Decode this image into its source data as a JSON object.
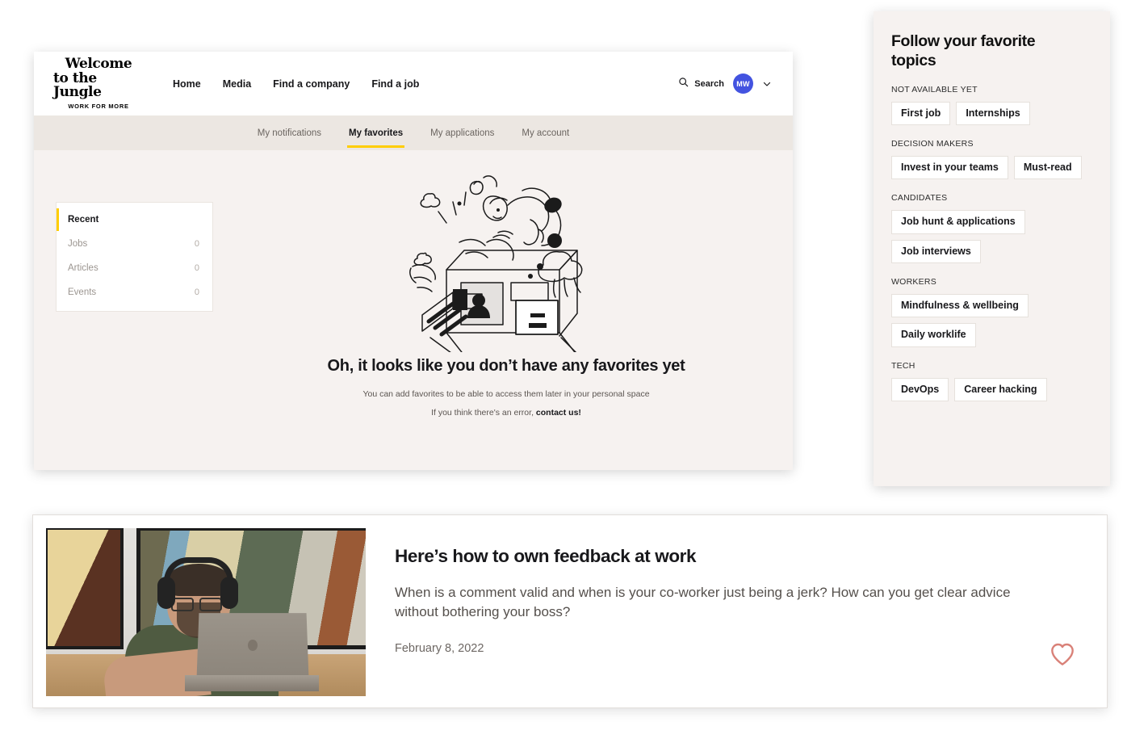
{
  "app": {
    "logo": {
      "line1": "Welcome",
      "line2": "to the Jungle",
      "tagline": "WORK FOR MORE"
    },
    "nav_links": [
      {
        "label": "Home"
      },
      {
        "label": "Media"
      },
      {
        "label": "Find a company"
      },
      {
        "label": "Find a job"
      }
    ],
    "search": {
      "label": "Search",
      "icon": "search-icon"
    },
    "account": {
      "initials": "MW",
      "avatar_color": "#4353e0",
      "chevron": "chevron-down-icon"
    },
    "tabs": [
      {
        "label": "My notifications",
        "active": false
      },
      {
        "label": "My favorites",
        "active": true
      },
      {
        "label": "My applications",
        "active": false
      },
      {
        "label": "My account",
        "active": false
      }
    ],
    "accent_color": "#ffcd00"
  },
  "sidebar": {
    "items": [
      {
        "label": "Recent",
        "count": "",
        "active": true
      },
      {
        "label": "Jobs",
        "count": "0",
        "active": false
      },
      {
        "label": "Articles",
        "count": "0",
        "active": false
      },
      {
        "label": "Events",
        "count": "0",
        "active": false
      }
    ]
  },
  "empty_state": {
    "illustration": "person-filing-cabinet-illustration",
    "title": "Oh, it looks like you don’t have any favorites yet",
    "subtitle": "You can add favorites to be able to access them later in your personal space",
    "error_prefix": "If you think there's an error, ",
    "error_link": "contact us!"
  },
  "topics_panel": {
    "title": "Follow your favorite topics",
    "groups": [
      {
        "label": "NOT AVAILABLE YET",
        "chips": [
          "First job",
          "Internships"
        ]
      },
      {
        "label": "DECISION MAKERS",
        "chips": [
          "Invest in your teams",
          "Must-read"
        ]
      },
      {
        "label": "CANDIDATES",
        "chips": [
          "Job hunt & applications",
          "Job interviews"
        ]
      },
      {
        "label": "WORKERS",
        "chips": [
          "Mindfulness & wellbeing",
          "Daily worklife"
        ]
      },
      {
        "label": "TECH",
        "chips": [
          "DevOps",
          "Career hacking"
        ]
      }
    ]
  },
  "article": {
    "thumbnail": "man-with-headphones-at-laptop-photo",
    "title": "Here’s how to own feedback at work",
    "description": "When is a comment valid and when is your co-worker just being a jerk? How can you get clear advice without bothering your boss?",
    "date": "February 8, 2022",
    "favorite_icon": "heart-outline-icon",
    "favorite_color": "#d98178"
  }
}
